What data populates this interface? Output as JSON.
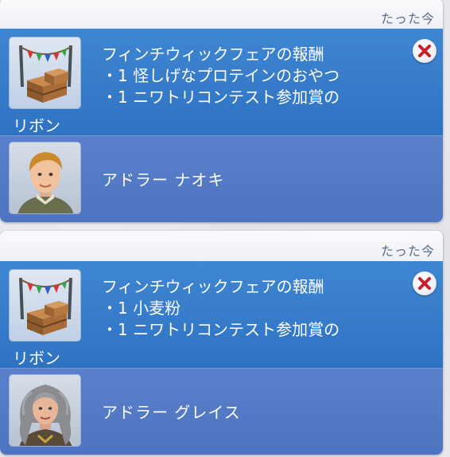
{
  "notifications": [
    {
      "time": "たった今",
      "reward_title": "フィンチウィックフェアの報酬",
      "reward_items": [
        "・1 怪しげなプロテインのおやつ",
        "・1 ニワトリコンテスト参加賞の"
      ],
      "icon_label": "リボン",
      "sim_name": "アドラー ナオキ"
    },
    {
      "time": "たった今",
      "reward_title": "フィンチウィックフェアの報酬",
      "reward_items": [
        "・1 小麦粉",
        "・1 ニワトリコンテスト参加賞の"
      ],
      "icon_label": "リボン",
      "sim_name": "アドラー グレイス"
    }
  ],
  "icons": {
    "reward": "fair-stall-icon",
    "close": "close-icon"
  },
  "colors": {
    "reward_bg": "#3a80cd",
    "sim_bg": "#5479c5",
    "close_x": "#c8202c"
  }
}
